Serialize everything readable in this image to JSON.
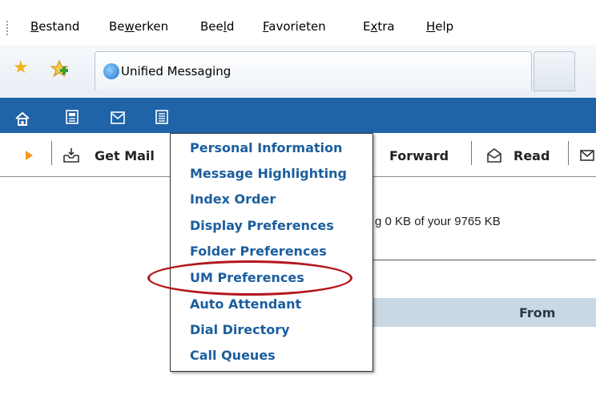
{
  "menubar": {
    "items": [
      {
        "pre": "",
        "ul": "B",
        "post": "estand"
      },
      {
        "pre": "Be",
        "ul": "w",
        "post": "erken"
      },
      {
        "pre": "Bee",
        "ul": "l",
        "post": "d"
      },
      {
        "pre": "",
        "ul": "F",
        "post": "avorieten"
      },
      {
        "pre": "E",
        "ul": "x",
        "post": "tra"
      },
      {
        "pre": "",
        "ul": "H",
        "post": "elp"
      }
    ]
  },
  "browser": {
    "tab_title": "Unified Messaging"
  },
  "toolbar": {
    "get_mail": "Get Mail",
    "forward": "Forward",
    "read": "Read"
  },
  "content": {
    "quota": "g 0 KB of your 9765 KB",
    "from_header": "From"
  },
  "dropdown": {
    "items": [
      "Personal Information",
      "Message Highlighting",
      "Index Order",
      "Display Preferences",
      "Folder Preferences",
      "UM Preferences",
      "Auto Attendant",
      "Dial Directory",
      "Call Queues"
    ]
  },
  "colors": {
    "nav_blue": "#1f63a8",
    "link_blue": "#1b5e9e",
    "annotation_red": "#b5161c",
    "header_band": "#c9d8e3"
  },
  "icons": {
    "favorites": "star-icon",
    "add_favorite": "add-favorite-icon",
    "browser": "ie-icon",
    "home": "home-icon",
    "contacts": "address-book-icon",
    "mail": "envelope-icon",
    "notes": "notes-icon",
    "get_mail": "inbox-icon",
    "read": "open-envelope-icon"
  }
}
